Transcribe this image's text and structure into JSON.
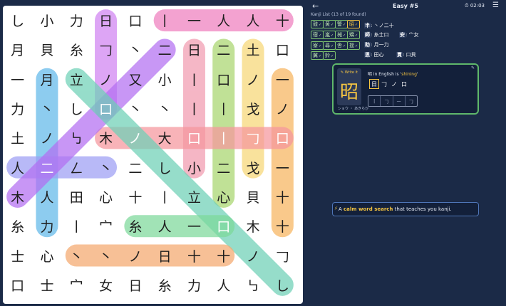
{
  "header": {
    "back_label": "←",
    "title": "Easy #5",
    "timer": "⏱ 02:03",
    "menu_label": "☰"
  },
  "grid": [
    [
      "し",
      "小",
      "力",
      "日",
      "口",
      "丨",
      "一",
      "人",
      "人",
      "十"
    ],
    [
      "月",
      "貝",
      "糸",
      "𠃌",
      "丶",
      "二",
      "日",
      "二",
      "土",
      "口"
    ],
    [
      "一",
      "月",
      "立",
      "ノ",
      "又",
      "小",
      "丨",
      "口",
      "ノ",
      "一"
    ],
    [
      "力",
      "丶",
      "し",
      "口",
      "丶",
      "丶",
      "丨",
      "丨",
      "戈",
      "ノ"
    ],
    [
      "土",
      "ノ",
      "㇉",
      "木",
      "ノ",
      "大",
      "口",
      "丨",
      "𠃌",
      "口"
    ],
    [
      "人",
      "二",
      "ㄥ",
      "丶",
      "二",
      "し",
      "小",
      "二",
      "戈",
      "一"
    ],
    [
      "木",
      "人",
      "田",
      "心",
      "十",
      "丨",
      "立",
      "心",
      "貝",
      "十"
    ],
    [
      "糸",
      "力",
      "丨",
      "宀",
      "糸",
      "人",
      "一",
      "口",
      "木",
      "十"
    ],
    [
      "士",
      "心",
      "丶",
      "丶",
      "ノ",
      "日",
      "十",
      "十",
      "ノ",
      "𠃌"
    ],
    [
      "口",
      "士",
      "宀",
      "女",
      "日",
      "糸",
      "力",
      "人",
      "㇉",
      "し"
    ]
  ],
  "found_words": [
    {
      "cells": [
        [
          0,
          5
        ],
        [
          0,
          9
        ]
      ],
      "color": "#ef7fbf"
    },
    {
      "cells": [
        [
          0,
          3
        ],
        [
          3,
          3
        ]
      ],
      "color": "#d083f2"
    },
    {
      "cells": [
        [
          1,
          6
        ],
        [
          5,
          6
        ]
      ],
      "color": "#f29bb0"
    },
    {
      "cells": [
        [
          1,
          7
        ],
        [
          6,
          7
        ]
      ],
      "color": "#a9d66f"
    },
    {
      "cells": [
        [
          1,
          8
        ],
        [
          5,
          8
        ]
      ],
      "color": "#f7d777"
    },
    {
      "cells": [
        [
          2,
          9
        ],
        [
          7,
          9
        ]
      ],
      "color": "#f7b55f"
    },
    {
      "cells": [
        [
          2,
          1
        ],
        [
          7,
          1
        ]
      ],
      "color": "#62b9ea"
    },
    {
      "cells": [
        [
          4,
          3
        ],
        [
          4,
          9
        ]
      ],
      "color": "#f6979e"
    },
    {
      "cells": [
        [
          5,
          0
        ],
        [
          5,
          3
        ]
      ],
      "color": "#9d9ff5"
    },
    {
      "cells": [
        [
          6,
          0
        ],
        [
          1,
          5
        ]
      ],
      "color": "#b36ff2"
    },
    {
      "cells": [
        [
          2,
          2
        ],
        [
          9,
          9
        ]
      ],
      "color": "#6fd1b7"
    },
    {
      "cells": [
        [
          7,
          4
        ],
        [
          7,
          7
        ]
      ],
      "color": "#7dd99a"
    },
    {
      "cells": [
        [
          8,
          2
        ],
        [
          8,
          7
        ]
      ],
      "color": "#f5a96e"
    }
  ],
  "kanji_list": {
    "title": "Kanji List (13 of 19 found)",
    "chips": [
      {
        "label": "鼓",
        "selected": false
      },
      {
        "label": "黄",
        "selected": false
      },
      {
        "label": "警",
        "selected": false
      },
      {
        "label": "昭",
        "selected": true
      },
      {
        "label": "宿",
        "selected": false
      },
      {
        "label": "嵐",
        "selected": false
      },
      {
        "label": "械",
        "selected": false
      },
      {
        "label": "矯",
        "selected": false
      },
      {
        "label": "寮",
        "selected": false
      },
      {
        "label": "尋",
        "selected": false
      },
      {
        "label": "舎",
        "selected": false
      },
      {
        "label": "揺",
        "selected": false
      },
      {
        "label": "翼",
        "selected": false
      },
      {
        "label": "鈴",
        "selected": false
      }
    ],
    "chip_check": "✓",
    "definitions": [
      {
        "kanji": "半",
        "parts": ": 丶ノ二十"
      },
      {
        "kanji": "師",
        "parts": ": 糸士口"
      },
      {
        "kanji": "安",
        "parts": ": 宀女"
      },
      {
        "kanji": "助",
        "parts": ": 月一力"
      },
      {
        "kanji": "思",
        "parts": ": 田心"
      },
      {
        "kanji": "貫",
        "parts": ": 口貝"
      }
    ]
  },
  "card": {
    "write_label": "✎ Write it",
    "kanji": "昭",
    "pronunciation": "ショウ ・ あきらか",
    "meaning_prefix": "昭 in English is '",
    "meaning_word": "shining",
    "meaning_suffix": "'",
    "components": [
      "日",
      "𠃌",
      "ノ",
      "口"
    ],
    "strokes": [
      "|",
      "𠃌",
      "一",
      "𠃌"
    ],
    "corner_icon": "✎"
  },
  "tagline": {
    "prefix": "A ",
    "highlight": "calm word search",
    "suffix": " that teaches you kanji.",
    "icon": "⚡"
  },
  "colors": {
    "background": "#1b2a47",
    "board": "#ffffff",
    "accent": "#f5c542",
    "chip_green": "#7ec36f"
  }
}
